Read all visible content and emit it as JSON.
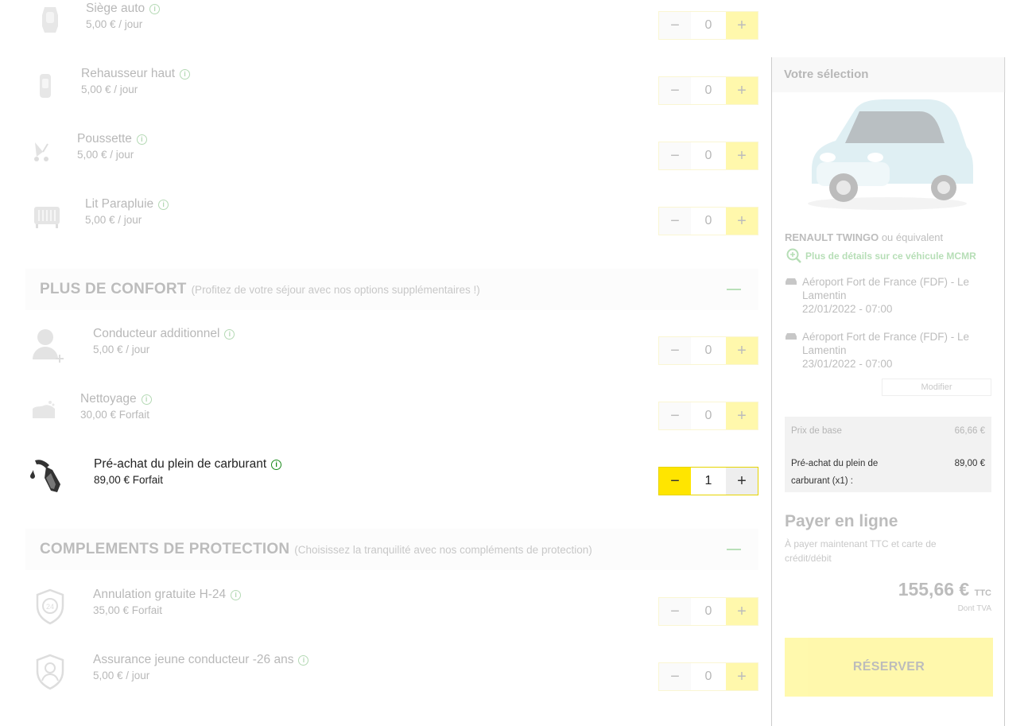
{
  "options_top": [
    {
      "title": "Siège auto",
      "price": "5,00 € / jour",
      "qty": "0",
      "icon": "car-seat-icon",
      "name": "siege-auto"
    },
    {
      "title": "Rehausseur haut",
      "price": "5,00 € / jour",
      "qty": "0",
      "icon": "booster-seat-icon",
      "name": "rehausseur-haut"
    },
    {
      "title": "Poussette",
      "price": "5,00 € / jour",
      "qty": "0",
      "icon": "stroller-icon",
      "name": "poussette"
    },
    {
      "title": "Lit Parapluie",
      "price": "5,00 € / jour",
      "qty": "0",
      "icon": "travel-cot-icon",
      "name": "lit-parapluie"
    }
  ],
  "sections": {
    "confort": {
      "title": "PLUS DE CONFORT",
      "subtitle": "(Profitez de votre séjour avec nos options supplémentaires !)"
    },
    "protection": {
      "title": "COMPLEMENTS DE PROTECTION",
      "subtitle": "(Choisissez la tranquilité avec nos compléments de protection)"
    }
  },
  "options_confort": [
    {
      "title": "Conducteur additionnel",
      "price": "5,00 € / jour",
      "qty": "0",
      "icon": "additional-driver-icon",
      "name": "conducteur-additionnel"
    },
    {
      "title": "Nettoyage",
      "price": "30,00 € Forfait",
      "qty": "0",
      "icon": "cleaning-icon",
      "name": "nettoyage"
    },
    {
      "title": "Pré-achat du plein de carburant",
      "price": "89,00 € Forfait",
      "qty": "1",
      "icon": "fuel-pump-icon",
      "name": "pre-achat-carburant"
    }
  ],
  "options_protection": [
    {
      "title": "Annulation gratuite H-24",
      "price": "35,00 € Forfait",
      "qty": "0",
      "icon": "shield-24-icon",
      "name": "annulation-gratuite"
    },
    {
      "title": "Assurance jeune conducteur -26 ans",
      "price": "5,00 € / jour",
      "qty": "0",
      "icon": "shield-driver-icon",
      "name": "assurance-jeune"
    }
  ],
  "summary": {
    "title": "Votre sélection",
    "car_model": "RENAULT TWINGO",
    "car_equiv": "ou équivalent",
    "details_link": "Plus de détails sur ce véhicule MCMR",
    "pickup": {
      "place": "Aéroport Fort de France (FDF) - Le Lamentin",
      "date": "22/01/2022 - 07:00"
    },
    "dropoff": {
      "place": "Aéroport Fort de France (FDF) - Le Lamentin",
      "date": "23/01/2022 - 07:00"
    },
    "modify_label": "Modifier",
    "base_label": "Prix de base",
    "base_price": "66,66 €",
    "fuel_label": "Pré-achat du plein de carburant (x1) :",
    "fuel_price": "89,00 €",
    "pay_title": "Payer en ligne",
    "pay_sub": "À payer maintenant TTC et carte de crédit/débit",
    "total": "155,66 €",
    "total_suffix": "TTC",
    "total_sub": "Dont TVA",
    "reserve_label": "RÉSERVER"
  },
  "colors": {
    "accent": "#ffeb00",
    "link_green": "#1e9a1e",
    "section_bg": "#f7f7f7"
  }
}
